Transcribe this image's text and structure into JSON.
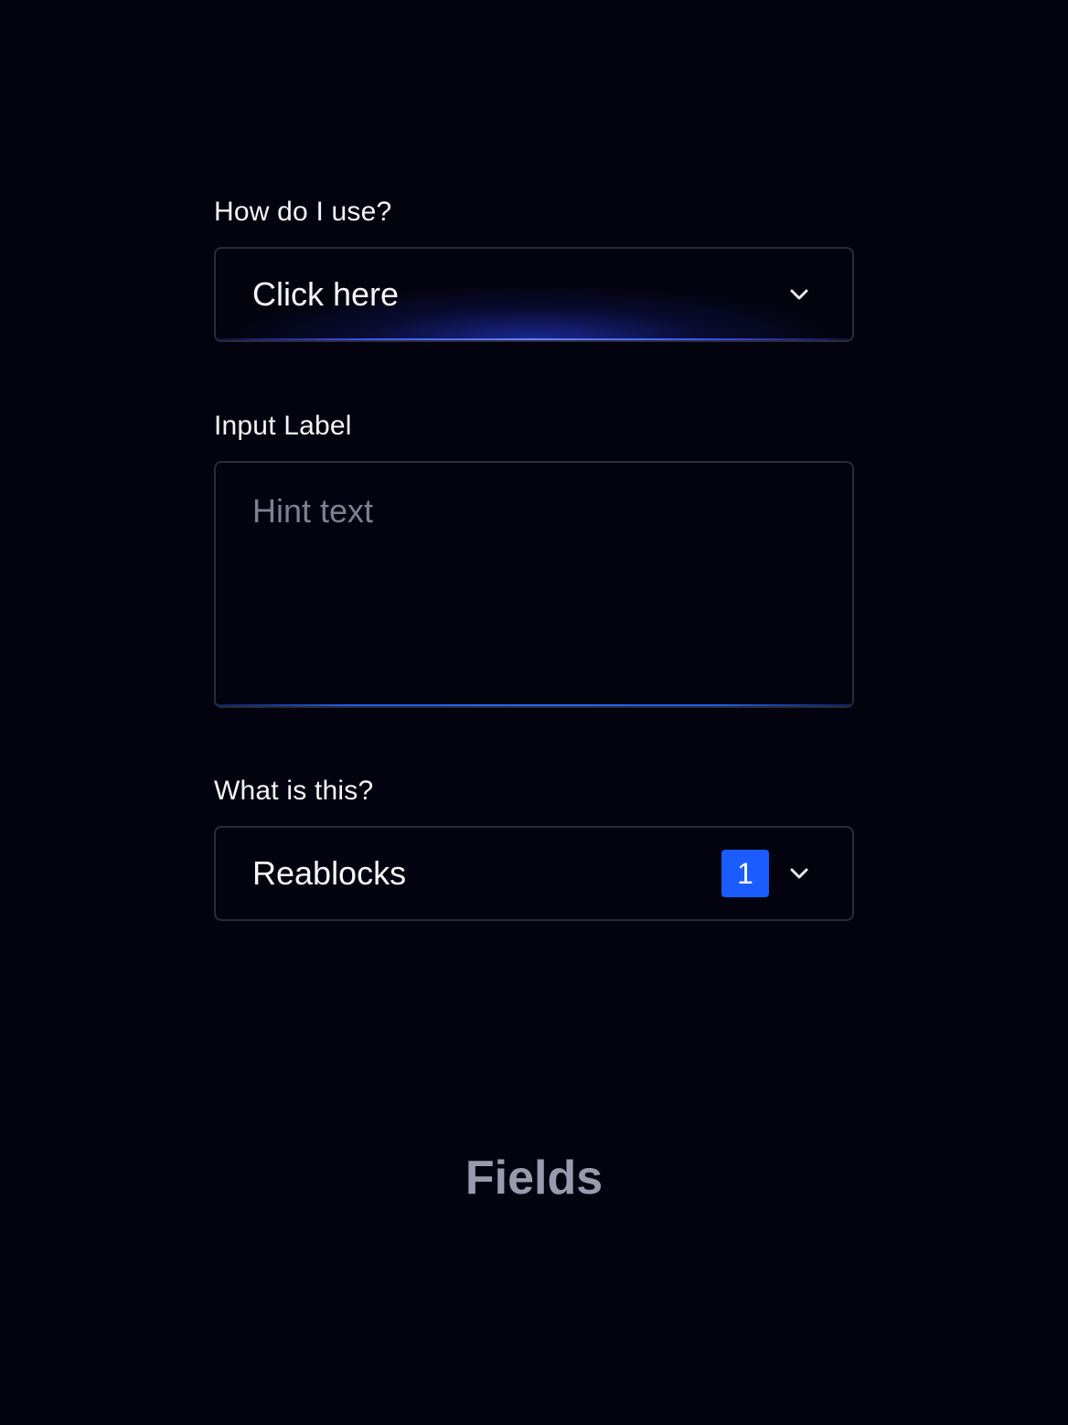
{
  "fields": [
    {
      "label": "How do I use?",
      "type": "select",
      "value": "Click here"
    },
    {
      "label": "Input Label",
      "type": "textarea",
      "placeholder": "Hint text"
    },
    {
      "label": "What is this?",
      "type": "select",
      "value": "Reablocks",
      "badge": "1"
    }
  ],
  "icons": {
    "chevron": "chevron-down-icon"
  },
  "colors": {
    "background": "#03030f",
    "border": "#2a2b3a",
    "accent": "#1a5cff",
    "glow": "#3d5bff",
    "hint": "#7d7f93",
    "title": "#9a9aae"
  },
  "footer": {
    "title": "Fields"
  }
}
